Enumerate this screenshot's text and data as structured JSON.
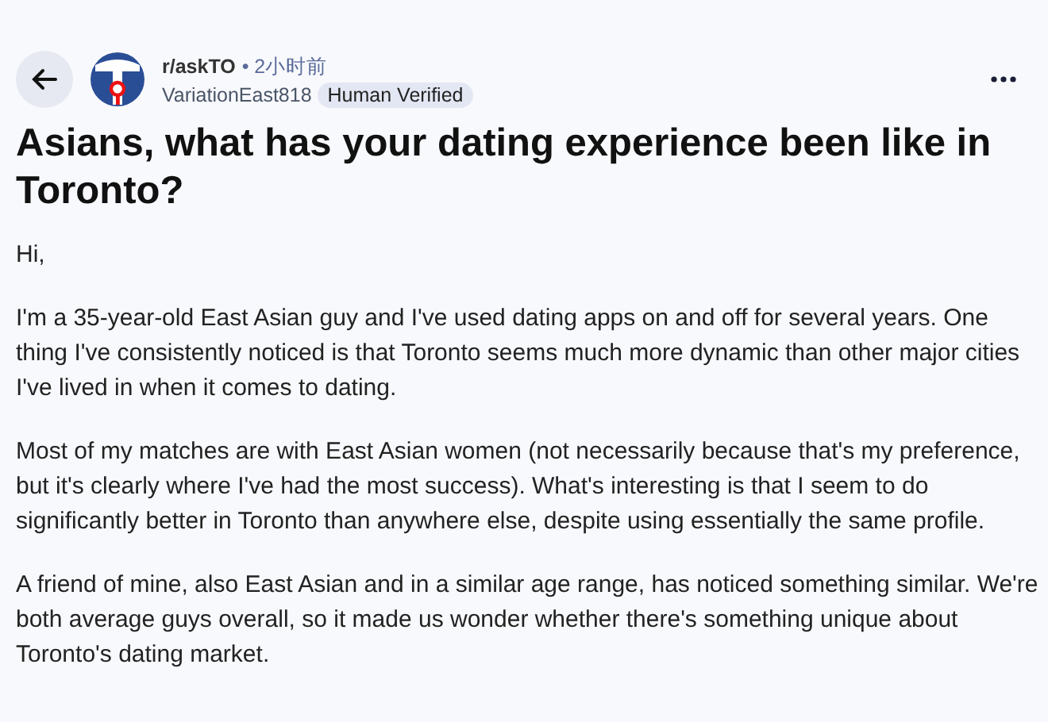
{
  "post": {
    "community": "r/askTO",
    "time": "• 2小时前",
    "author": "VariationEast818",
    "flair": "Human Verified",
    "title": "Asians, what has your dating experience been like in Toronto?",
    "paragraphs": [
      "Hi,",
      "I'm a 35-year-old East Asian guy and I've used dating apps on and off for several years. One thing I've consistently noticed is that Toronto seems much more dynamic than other major cities I've lived in when it comes to dating.",
      "Most of my matches are with East Asian women (not necessarily because that's my preference, but it's clearly where I've had the most success). What's interesting is that I seem to do significantly better in Toronto than anywhere else, despite using essentially the same profile.",
      "A friend of mine, also East Asian and in a similar age range, has noticed something similar. We're both average guys overall, so it made us wonder whether there's something unique about Toronto's dating market."
    ]
  }
}
